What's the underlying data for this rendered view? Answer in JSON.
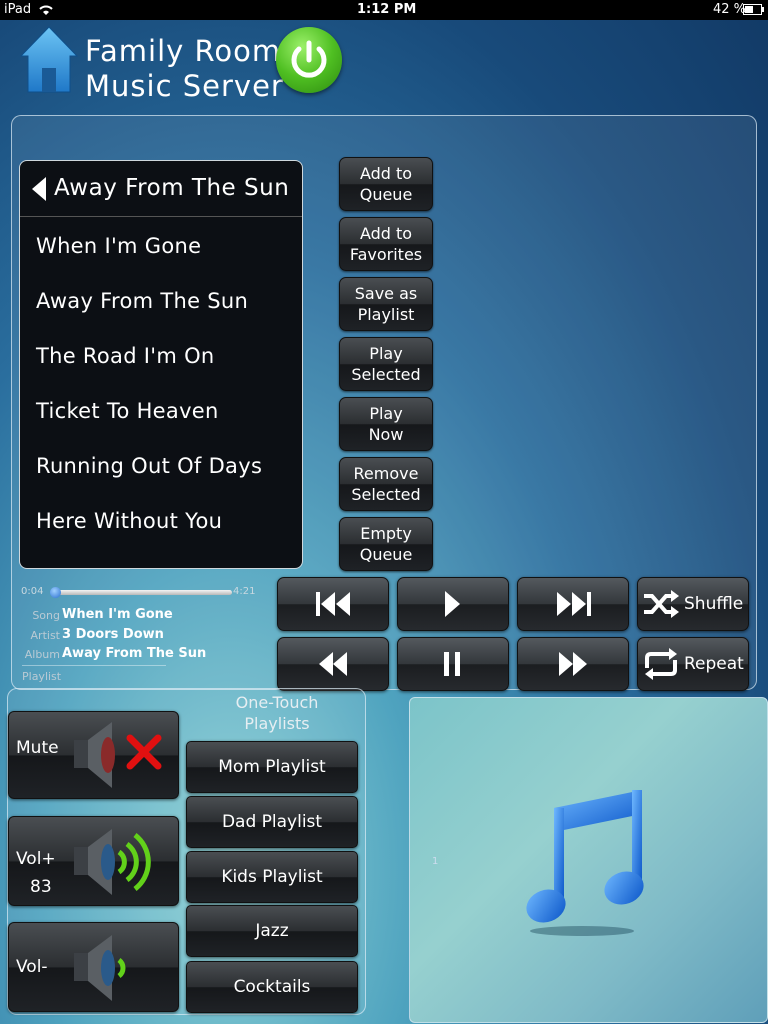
{
  "status_bar": {
    "device": "iPad",
    "time": "1:12 PM",
    "battery": "42 %"
  },
  "header": {
    "title_line1": "Family Room",
    "title_line2": "Music Server",
    "home_icon": "home-icon",
    "power_icon": "power-icon"
  },
  "list": {
    "header": "Away From The Sun",
    "tracks": [
      "When I'm Gone",
      "Away From The Sun",
      "The Road I'm On",
      "Ticket To Heaven",
      "Running Out Of Days",
      "Here Without You"
    ]
  },
  "side_buttons": [
    "Add to\nQueue",
    "Add to\nFavorites",
    "Save as\nPlaylist",
    "Play\nSelected",
    "Play\nNow",
    "Remove\nSelected",
    "Empty\nQueue"
  ],
  "progress": {
    "elapsed": "0:04",
    "total": "4:21",
    "fraction": 0.015
  },
  "now_playing": {
    "song_label": "Song",
    "song": "When I'm Gone",
    "artist_label": "Artist",
    "artist": "3 Doors Down",
    "album_label": "Album",
    "album": "Away From The Sun",
    "playlist_label": "Playlist"
  },
  "transport": {
    "shuffle": "Shuffle",
    "repeat": "Repeat"
  },
  "volume": {
    "mute": "Mute",
    "vol_up": "Vol+",
    "level": "83",
    "vol_down": "Vol-"
  },
  "playlists": {
    "title": "One-Touch\nPlaylists",
    "items": [
      "Mom Playlist",
      "Dad Playlist",
      "Kids Playlist",
      "Jazz",
      "Cocktails"
    ]
  },
  "art": {
    "marker": "1",
    "icon": "music-note-icon"
  },
  "colors": {
    "power_green": "#4fbf22",
    "mute_red": "#e11010",
    "speaker_green": "#62d11a",
    "note_blue": "#1f7fe8"
  }
}
